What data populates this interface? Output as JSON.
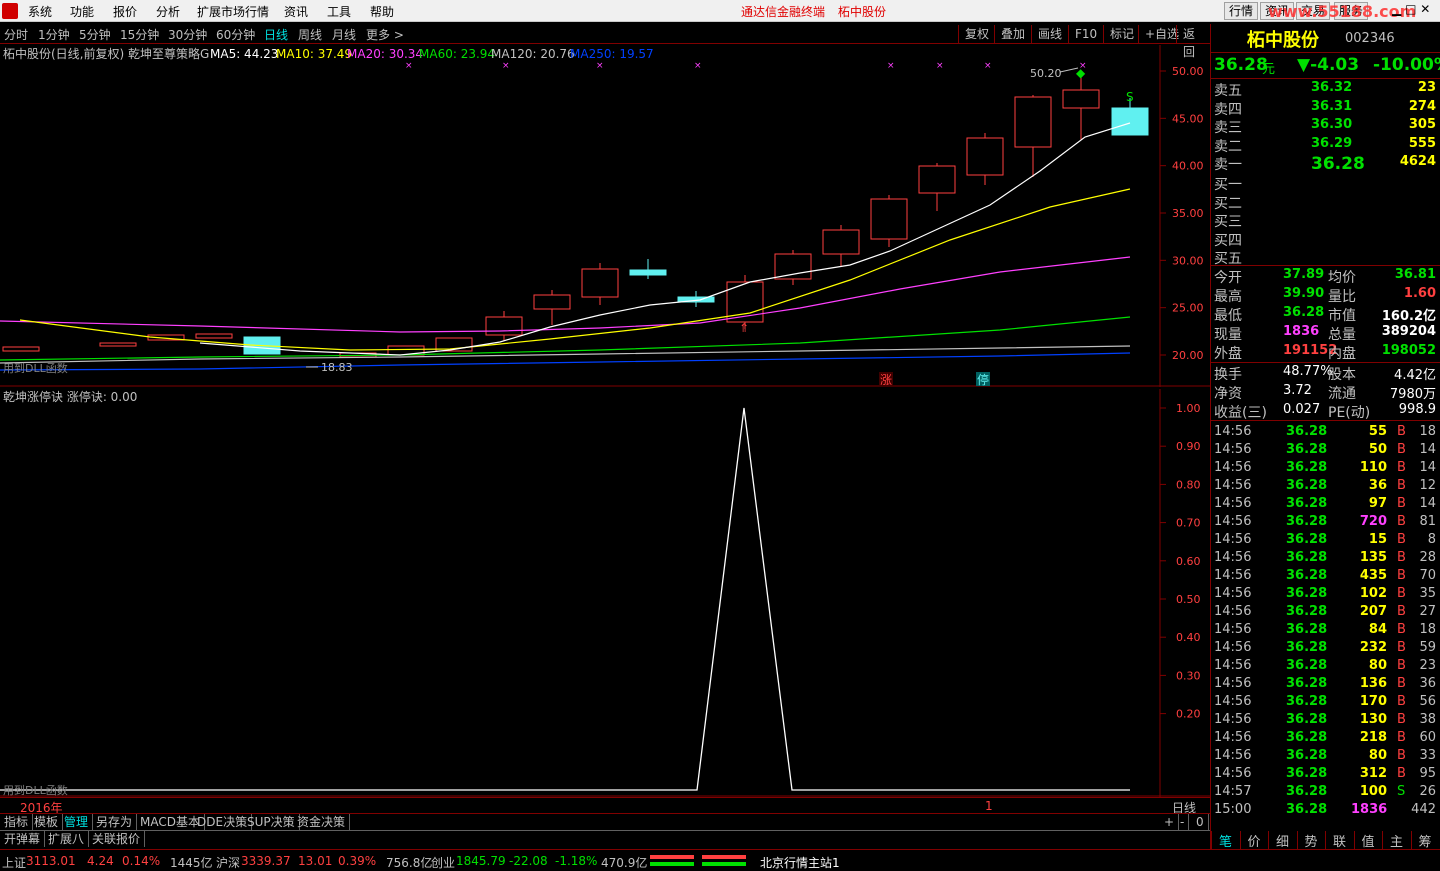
{
  "menu": {
    "items": [
      "系统",
      "功能",
      "报价",
      "分析",
      "扩展市场行情",
      "资讯",
      "工具",
      "帮助"
    ],
    "center_title": "通达信金融终端",
    "center_stock": "柘中股份",
    "right_buttons": [
      "行情",
      "资讯",
      "交易",
      "服务"
    ],
    "watermark": "www.55188.com"
  },
  "period_bar": {
    "periods": [
      "分时",
      "1分钟",
      "5分钟",
      "15分钟",
      "30分钟",
      "60分钟",
      "日线",
      "周线",
      "月线",
      "更多 >"
    ],
    "active": "日线",
    "tools": [
      "复权",
      "叠加",
      "画线",
      "F10",
      "标记",
      "+自选",
      "返回"
    ]
  },
  "main_chart": {
    "header_name": "柘中股份(日线,前复权) 乾坤至尊策略G",
    "ma": [
      {
        "label": "MA5: 44.23",
        "color": "#ffffff"
      },
      {
        "label": "MA10: 37.49",
        "color": "#ffff00"
      },
      {
        "label": "MA20: 30.34",
        "color": "#ff40ff"
      },
      {
        "label": "MA60: 23.94",
        "color": "#00e000"
      },
      {
        "label": "MA120: 20.76",
        "color": "#c0c0c0"
      },
      {
        "label": "MA250: 19.57",
        "color": "#0040ff"
      }
    ],
    "y_ticks": [
      "50.00",
      "45.00",
      "40.00",
      "35.00",
      "30.00",
      "25.00",
      "20.00"
    ],
    "high_label": "50.20",
    "low_label": "18.83",
    "dll_note": "用到DLL函数",
    "marker_zhang": "涨",
    "marker_ting": "停",
    "sell_marker": "S"
  },
  "sub_chart": {
    "header": "乾坤涨停诀 涨停诀: 0.00",
    "y_ticks": [
      "1.00",
      "0.90",
      "0.80",
      "0.70",
      "0.60",
      "0.50",
      "0.40",
      "0.30",
      "0.20"
    ],
    "dll_note": "用到DLL函数",
    "year": "2016年",
    "period_label": "日线",
    "tick_1": "1"
  },
  "tabs_row1": [
    "指标",
    "模板",
    "管理",
    "另存为",
    "MACD基本",
    "DDE决策",
    "SUP决策",
    "资金决策"
  ],
  "tabs_row1_active": "管理",
  "tabs_row1_right": [
    "+",
    "-",
    "0"
  ],
  "tabs_row2": [
    "开弹幕",
    "扩展八",
    "关联报价"
  ],
  "stock": {
    "name": "柘中股份",
    "code": "002346",
    "price": "36.28",
    "price_unit": "元",
    "change": "▼-4.03",
    "pct": "-10.00%"
  },
  "order_book": {
    "sell": [
      {
        "label": "卖五",
        "price": "36.32",
        "vol": "23"
      },
      {
        "label": "卖四",
        "price": "36.31",
        "vol": "274"
      },
      {
        "label": "卖三",
        "price": "36.30",
        "vol": "305"
      },
      {
        "label": "卖二",
        "price": "36.29",
        "vol": "555"
      },
      {
        "label": "卖一",
        "price": "36.28",
        "vol": "4624"
      }
    ],
    "buy": [
      "买一",
      "买二",
      "买三",
      "买四",
      "买五"
    ]
  },
  "quote_stats": [
    {
      "l1": "今开",
      "v1": "37.89",
      "c1": "green",
      "l2": "均价",
      "v2": "36.81",
      "c2": "green"
    },
    {
      "l1": "最高",
      "v1": "39.90",
      "c1": "green",
      "l2": "量比",
      "v2": "1.60",
      "c2": "red"
    },
    {
      "l1": "最低",
      "v1": "36.28",
      "c1": "green",
      "l2": "市值",
      "v2": "160.2亿",
      "c2": "white"
    },
    {
      "l1": "现量",
      "v1": "1836",
      "c1": "magenta",
      "l2": "总量",
      "v2": "389204",
      "c2": "white"
    },
    {
      "l1": "外盘",
      "v1": "191152",
      "c1": "red",
      "l2": "内盘",
      "v2": "198052",
      "c2": "green"
    }
  ],
  "fundamentals": [
    {
      "l1": "换手",
      "v1": "48.77%",
      "l2": "股本",
      "v2": "4.42亿"
    },
    {
      "l1": "净资",
      "v1": "3.72",
      "l2": "流通",
      "v2": "7980万"
    },
    {
      "l1": "收益(三)",
      "v1": "0.027",
      "l2": "PE(动)",
      "v2": "998.9"
    }
  ],
  "ticks": [
    {
      "t": "14:56",
      "p": "36.28",
      "v": "55",
      "bs": "B",
      "n": "18"
    },
    {
      "t": "14:56",
      "p": "36.28",
      "v": "50",
      "bs": "B",
      "n": "14"
    },
    {
      "t": "14:56",
      "p": "36.28",
      "v": "110",
      "bs": "B",
      "n": "14"
    },
    {
      "t": "14:56",
      "p": "36.28",
      "v": "36",
      "bs": "B",
      "n": "12"
    },
    {
      "t": "14:56",
      "p": "36.28",
      "v": "97",
      "bs": "B",
      "n": "14"
    },
    {
      "t": "14:56",
      "p": "36.28",
      "v": "720",
      "bs": "B",
      "n": "81"
    },
    {
      "t": "14:56",
      "p": "36.28",
      "v": "15",
      "bs": "B",
      "n": "8"
    },
    {
      "t": "14:56",
      "p": "36.28",
      "v": "135",
      "bs": "B",
      "n": "28"
    },
    {
      "t": "14:56",
      "p": "36.28",
      "v": "435",
      "bs": "B",
      "n": "70"
    },
    {
      "t": "14:56",
      "p": "36.28",
      "v": "102",
      "bs": "B",
      "n": "35"
    },
    {
      "t": "14:56",
      "p": "36.28",
      "v": "207",
      "bs": "B",
      "n": "27"
    },
    {
      "t": "14:56",
      "p": "36.28",
      "v": "84",
      "bs": "B",
      "n": "18"
    },
    {
      "t": "14:56",
      "p": "36.28",
      "v": "232",
      "bs": "B",
      "n": "59"
    },
    {
      "t": "14:56",
      "p": "36.28",
      "v": "80",
      "bs": "B",
      "n": "23"
    },
    {
      "t": "14:56",
      "p": "36.28",
      "v": "136",
      "bs": "B",
      "n": "36"
    },
    {
      "t": "14:56",
      "p": "36.28",
      "v": "170",
      "bs": "B",
      "n": "56"
    },
    {
      "t": "14:56",
      "p": "36.28",
      "v": "130",
      "bs": "B",
      "n": "38"
    },
    {
      "t": "14:56",
      "p": "36.28",
      "v": "218",
      "bs": "B",
      "n": "60"
    },
    {
      "t": "14:56",
      "p": "36.28",
      "v": "80",
      "bs": "B",
      "n": "33"
    },
    {
      "t": "14:56",
      "p": "36.28",
      "v": "312",
      "bs": "B",
      "n": "95"
    },
    {
      "t": "14:57",
      "p": "36.28",
      "v": "100",
      "bs": "S",
      "n": "26"
    },
    {
      "t": "15:00",
      "p": "36.28",
      "v": "1836",
      "bs": "",
      "n": "442"
    }
  ],
  "side_tabs": [
    "笔",
    "价",
    "细",
    "势",
    "联",
    "值",
    "主",
    "筹"
  ],
  "status": {
    "sh_label": "上证",
    "sh_val": "3113.01",
    "sh_chg": "4.24",
    "sh_pct": "0.14%",
    "sh_amt": "1445亿",
    "hs_label": "沪深",
    "hs_val": "3339.37",
    "hs_chg": "13.01",
    "hs_pct": "0.39%",
    "hs_amt": "756.8亿",
    "cy_label": "创业",
    "cy_val": "1845.79",
    "cy_chg": "-22.08",
    "cy_pct": "-1.18%",
    "cy_amt": "470.9亿",
    "station": "北京行情主站1"
  },
  "colors": {
    "up": "#ff4040",
    "down": "#00e000",
    "ma5": "#ffffff",
    "ma10": "#ffff00",
    "ma20": "#ff40ff",
    "ma60": "#00e000",
    "ma120": "#c0c0c0",
    "ma250": "#0040ff",
    "cyan_box": "#60f0f0",
    "grid": "#800000"
  }
}
